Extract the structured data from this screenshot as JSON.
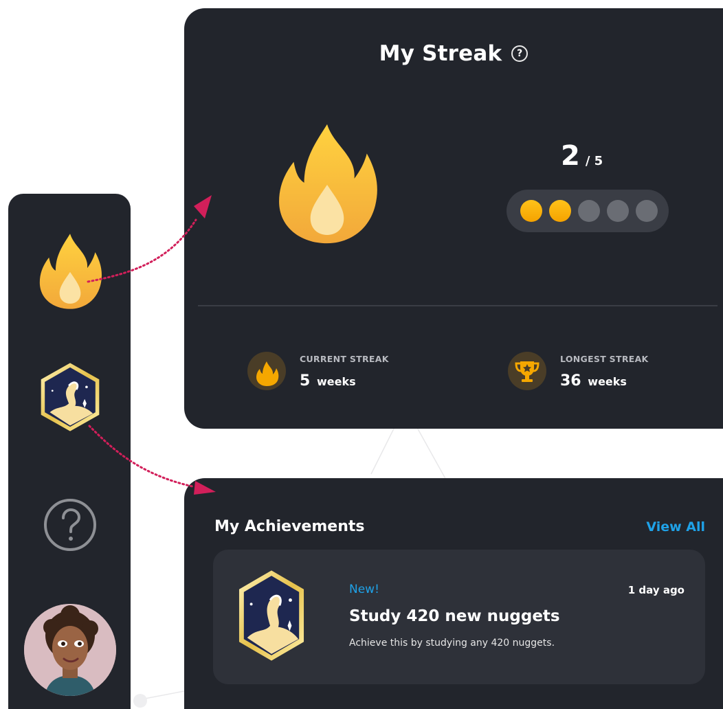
{
  "colors": {
    "panel": "#22252c",
    "card": "#2e3139",
    "accent_blue": "#1fa2e8",
    "flame_top": "#ffd23f",
    "flame_bottom": "#f2a83a",
    "arrow": "#d21f5a"
  },
  "sidebar": {
    "items": [
      {
        "icon": "flame-icon"
      },
      {
        "icon": "achievement-badge-icon"
      },
      {
        "icon": "help-circle-icon"
      },
      {
        "icon": "user-avatar"
      }
    ]
  },
  "streak": {
    "title": "My Streak",
    "help_glyph": "?",
    "current": "2",
    "separator": "/ 5",
    "progress": {
      "filled": 2,
      "total": 5
    },
    "stats": [
      {
        "label": "CURRENT STREAK",
        "value": "5",
        "unit": "weeks",
        "icon": "flame-icon"
      },
      {
        "label": "LONGEST STREAK",
        "value": "36",
        "unit": "weeks",
        "icon": "trophy-icon"
      }
    ]
  },
  "achievements": {
    "title": "My Achievements",
    "view_all": "View All",
    "item": {
      "tag": "New!",
      "time": "1 day ago",
      "name": "Study 420 new nuggets",
      "description": "Achieve this by studying any 420 nuggets."
    }
  }
}
